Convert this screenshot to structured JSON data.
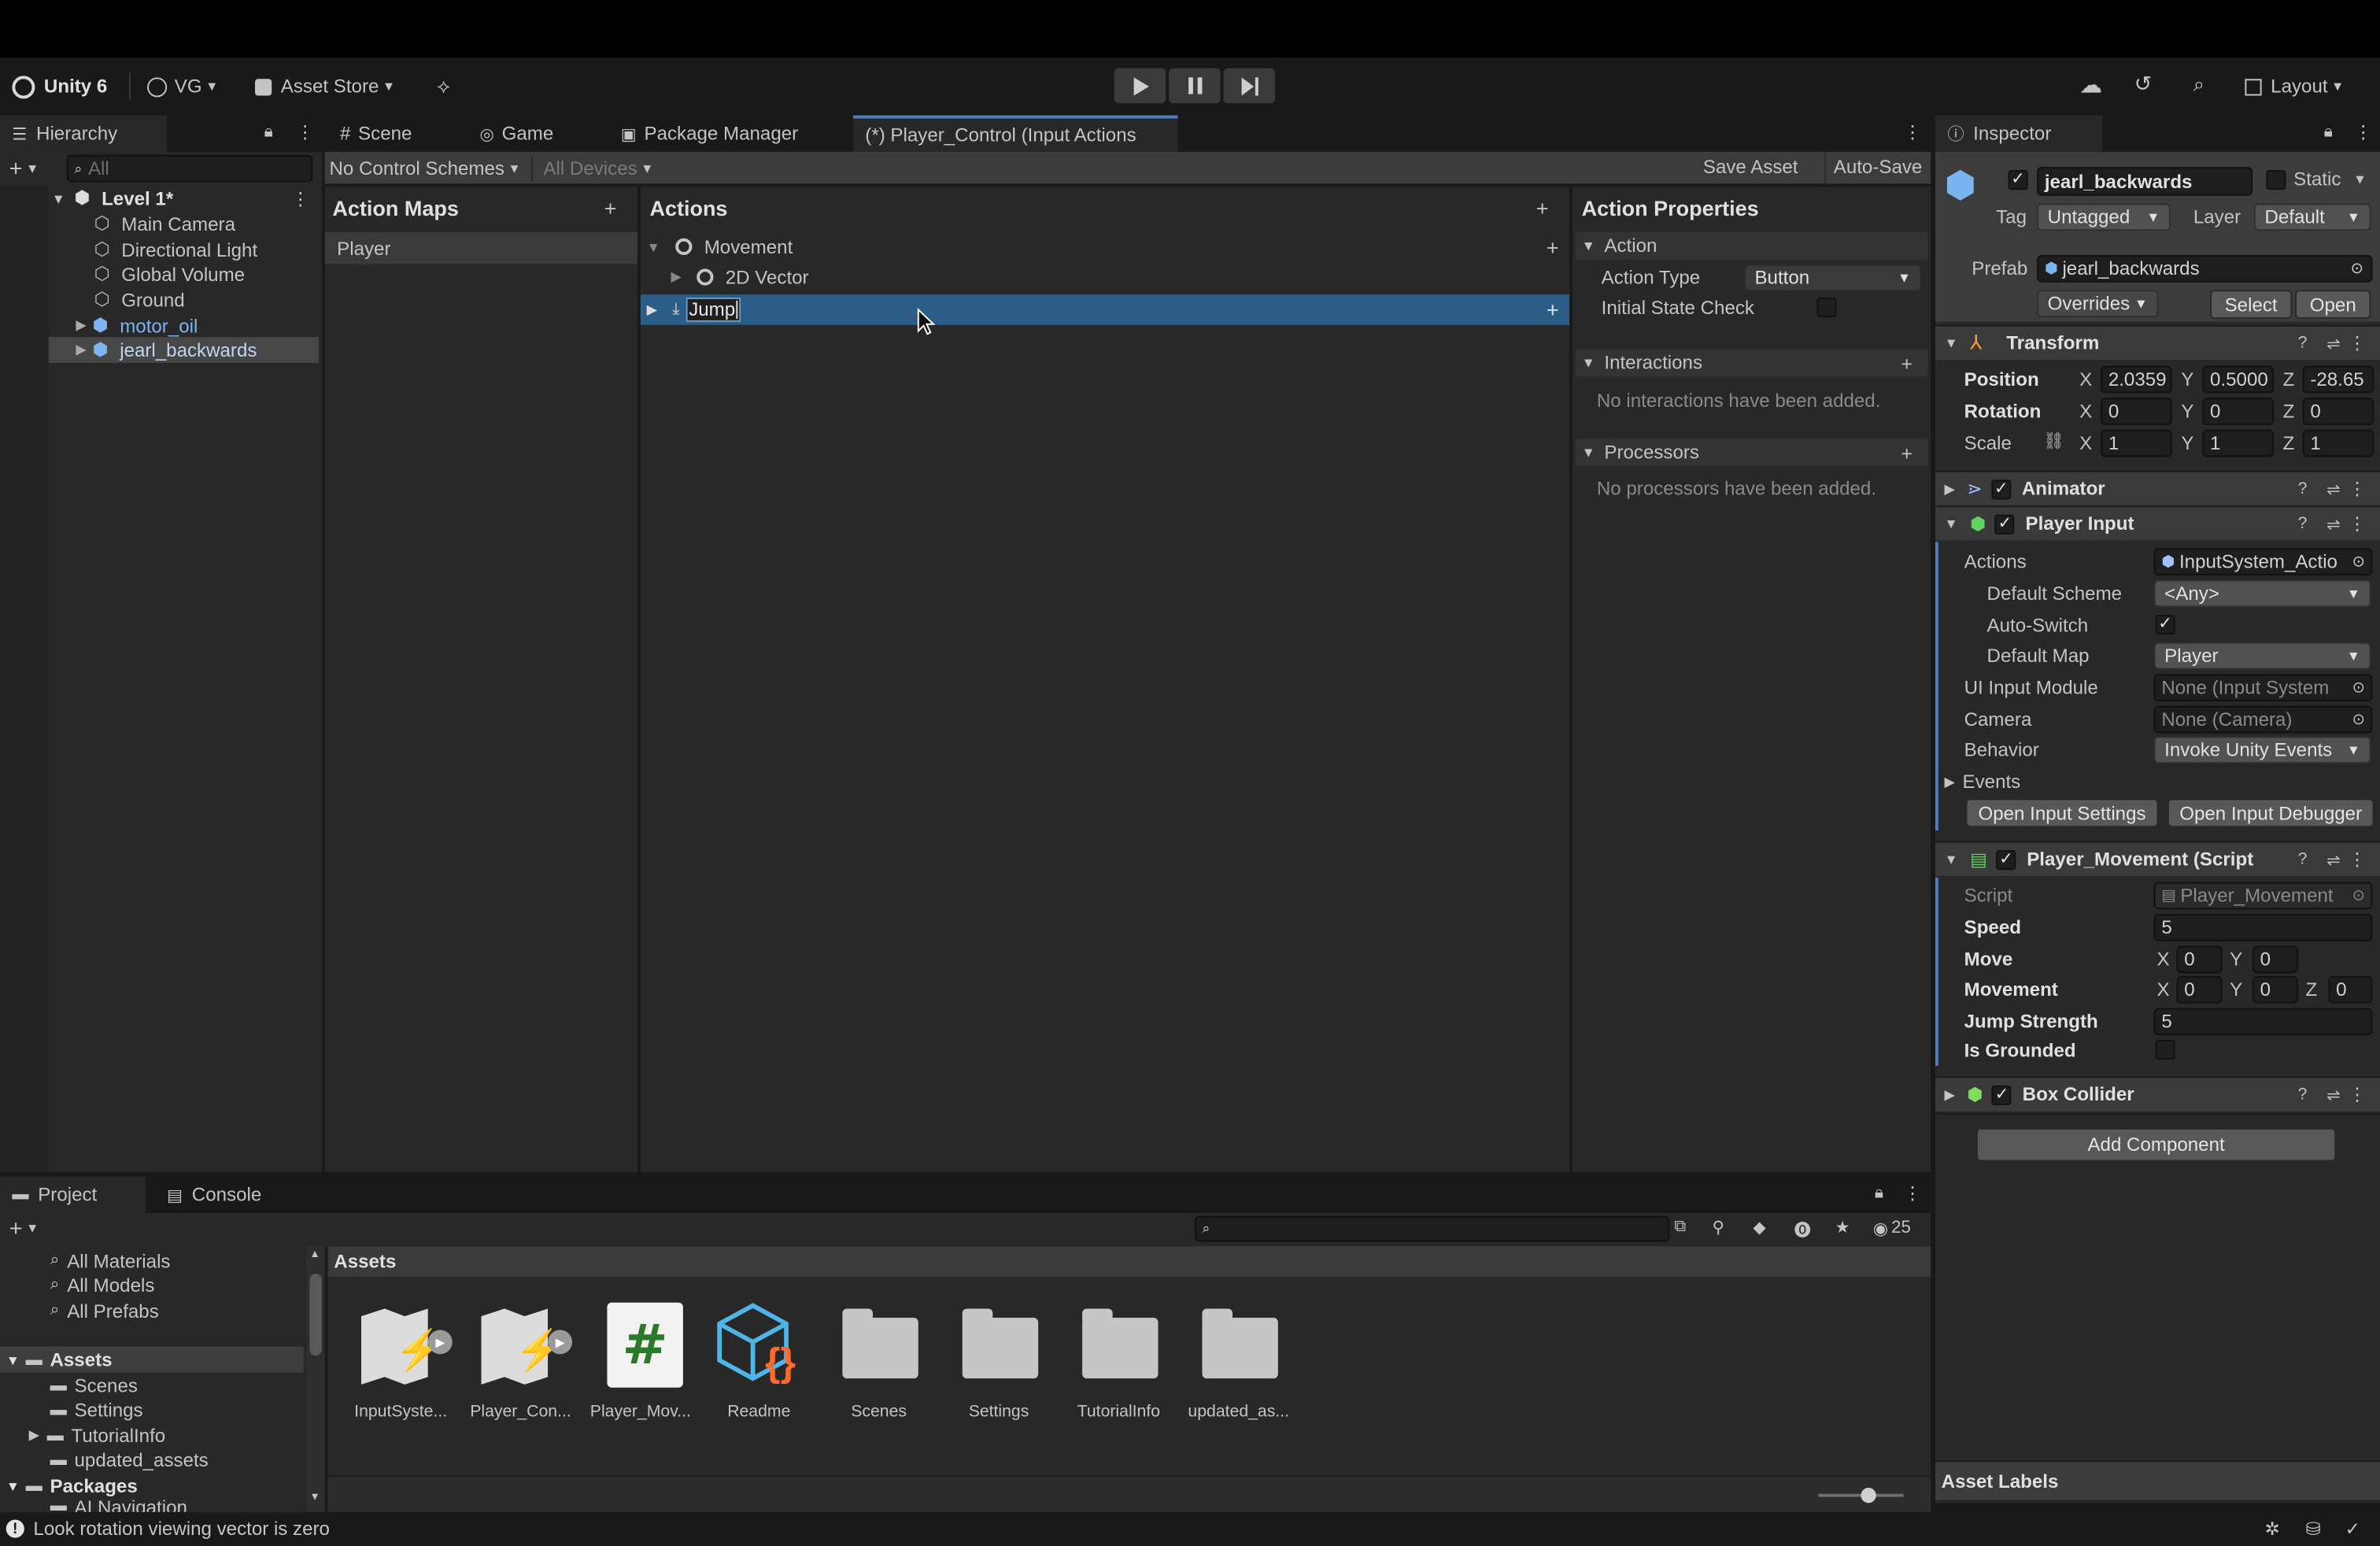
{
  "toolbar": {
    "app_name": "Unity 6",
    "account": "VG",
    "asset_store": "Asset Store",
    "layout": "Layout"
  },
  "hierarchy": {
    "tab": "Hierarchy",
    "search_placeholder": "All",
    "scene": "Level 1*",
    "items": [
      "Main Camera",
      "Directional Light",
      "Global Volume",
      "Ground",
      "motor_oil",
      "jearl_backwards"
    ]
  },
  "center_tabs": [
    "Scene",
    "Game",
    "Package Manager",
    "(*) Player_Control (Input Actions"
  ],
  "input_actions": {
    "control_schemes": "No Control Schemes",
    "devices": "All Devices",
    "save_asset": "Save Asset",
    "auto_save": "Auto-Save",
    "action_maps_title": "Action Maps",
    "maps": [
      "Player"
    ],
    "actions_title": "Actions",
    "actions": {
      "movement": "Movement",
      "vector": "2D Vector",
      "jump": "Jump"
    },
    "properties_title": "Action Properties",
    "action_section": "Action",
    "action_type_label": "Action Type",
    "action_type_value": "Button",
    "initial_state_label": "Initial State Check",
    "interactions_title": "Interactions",
    "interactions_empty": "No interactions have been added.",
    "processors_title": "Processors",
    "processors_empty": "No processors have been added."
  },
  "inspector": {
    "tab": "Inspector",
    "object_name": "jearl_backwards",
    "static_label": "Static",
    "tag_label": "Tag",
    "tag_value": "Untagged",
    "layer_label": "Layer",
    "layer_value": "Default",
    "prefab_label": "Prefab",
    "prefab_value": "jearl_backwards",
    "select": "Select",
    "open": "Open",
    "overrides": "Overrides",
    "transform": {
      "title": "Transform",
      "position_label": "Position",
      "position": [
        "2.0359",
        "0.5000",
        "-28.65"
      ],
      "rotation_label": "Rotation",
      "rotation": [
        "0",
        "0",
        "0"
      ],
      "scale_label": "Scale",
      "scale": [
        "1",
        "1",
        "1"
      ]
    },
    "animator_title": "Animator",
    "player_input": {
      "title": "Player Input",
      "actions_label": "Actions",
      "actions_value": "InputSystem_Actio",
      "default_scheme_label": "Default Scheme",
      "default_scheme_value": "<Any>",
      "auto_switch_label": "Auto-Switch",
      "default_map_label": "Default Map",
      "default_map_value": "Player",
      "ui_module_label": "UI Input Module",
      "ui_module_value": "None (Input System",
      "camera_label": "Camera",
      "camera_value": "None (Camera)",
      "behavior_label": "Behavior",
      "behavior_value": "Invoke Unity Events",
      "events_label": "Events",
      "open_settings": "Open Input Settings",
      "open_debugger": "Open Input Debugger"
    },
    "player_movement": {
      "title": "Player_Movement (Script",
      "script_label": "Script",
      "script_value": "Player_Movement",
      "speed_label": "Speed",
      "speed_value": "5",
      "move_label": "Move",
      "move": [
        "0",
        "0"
      ],
      "movement_label": "Movement",
      "movement": [
        "0",
        "0",
        "0"
      ],
      "jump_label": "Jump Strength",
      "jump_value": "5",
      "grounded_label": "Is Grounded"
    },
    "box_collider_title": "Box Collider",
    "add_component": "Add Component",
    "asset_labels": "Asset Labels",
    "axis": {
      "x": "X",
      "y": "Y",
      "z": "Z"
    }
  },
  "project": {
    "tab_project": "Project",
    "tab_console": "Console",
    "count": "25",
    "favorites": [
      "All Materials",
      "All Models",
      "All Prefabs"
    ],
    "assets_root": "Assets",
    "asset_folders": [
      "Scenes",
      "Settings",
      "TutorialInfo",
      "updated_assets"
    ],
    "packages_root": "Packages",
    "packages_partial": "AI Navigation",
    "breadcrumb": "Assets",
    "assets": [
      "InputSyste...",
      "Player_Con...",
      "Player_Mov...",
      "Readme",
      "Scenes",
      "Settings",
      "TutorialInfo",
      "updated_as..."
    ]
  },
  "status_bar": {
    "message": "Look rotation viewing vector is zero"
  },
  "colors": {
    "selection": "#2c5d87",
    "prefab_blue": "#7cb4f0",
    "accent": "#4c7fbf"
  }
}
